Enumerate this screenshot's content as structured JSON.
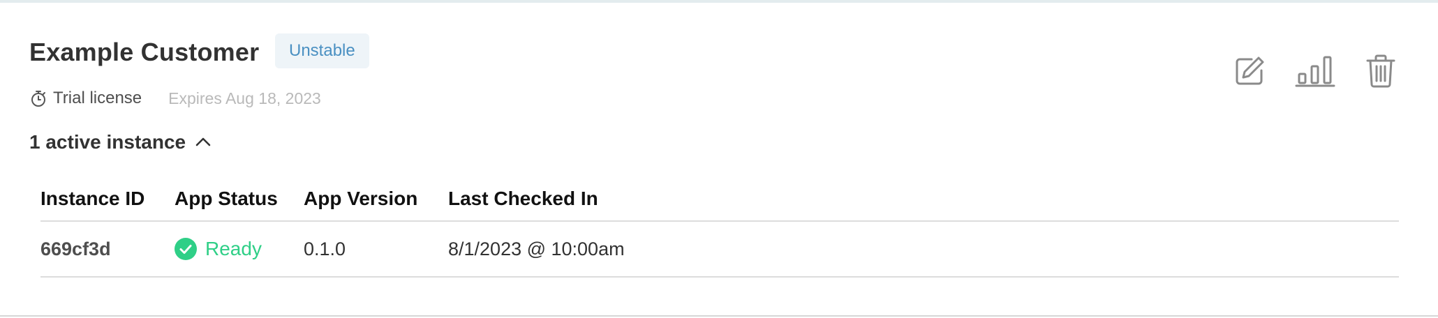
{
  "customer": {
    "name": "Example Customer",
    "channel_badge": "Unstable",
    "license_type": "Trial license",
    "expires": "Expires Aug 18, 2023"
  },
  "instances": {
    "toggle_label": "1 active instance",
    "columns": [
      "Instance ID",
      "App Status",
      "App Version",
      "Last Checked In"
    ],
    "rows": [
      {
        "instance_id": "669cf3d",
        "app_status": "Ready",
        "app_version": "0.1.0",
        "last_checked_in": "8/1/2023 @ 10:00am"
      }
    ]
  },
  "actions": {
    "edit_icon": "edit-icon",
    "analytics_icon": "bar-chart-icon",
    "delete_icon": "trash-icon"
  },
  "colors": {
    "badge_text": "#4a90c2",
    "badge_bg": "#eef4f8",
    "status_ready": "#2fcf87",
    "icon_gray": "#8a8a8a"
  }
}
